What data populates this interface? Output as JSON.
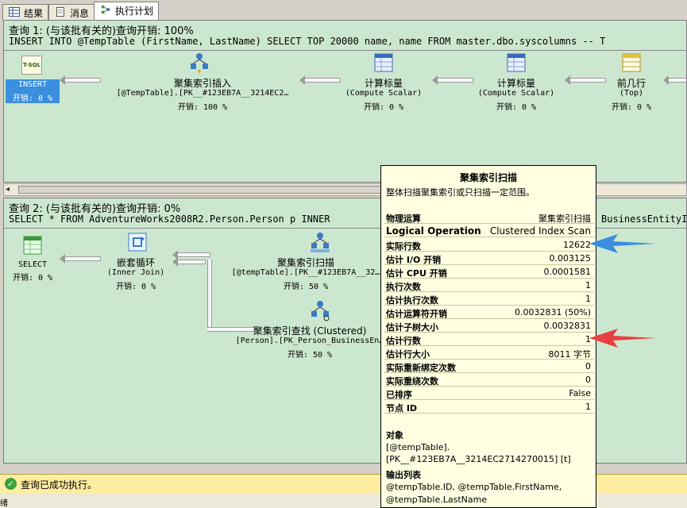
{
  "tabs": [
    {
      "label": "结果",
      "icon": "grid-icon"
    },
    {
      "label": "消息",
      "icon": "document-icon"
    },
    {
      "label": "执行计划",
      "icon": "plan-icon",
      "active": true
    }
  ],
  "query1": {
    "header": "查询 1: (与该批有关的)查询开销: 100%",
    "sql": "INSERT INTO @TempTable (FirstName, LastName) SELECT TOP 20000 name, name FROM master.dbo.syscolumns -- T",
    "nodes": {
      "insert": {
        "icon_label": "T-SQL",
        "title": "INSERT",
        "cost": "开销: 0 %"
      },
      "clustered_insert": {
        "title": "聚集索引插入",
        "sub": "[@TempTable].[PK__#123EB7A__3214EC2…",
        "cost": "开销: 100 %"
      },
      "compute1": {
        "title": "计算标量",
        "sub": "(Compute Scalar)",
        "cost": "开销: 0 %"
      },
      "compute2": {
        "title": "计算标量",
        "sub": "(Compute Scalar)",
        "cost": "开销: 0 %"
      },
      "top": {
        "title": "前几行",
        "sub": "(Top)",
        "cost": "开销: 0 %"
      }
    }
  },
  "query2": {
    "header": "查询 2: (与该批有关的)查询开销: 0%",
    "sql": "SELECT * FROM AdventureWorks2008R2.Person.Person p INNER",
    "sql_tail": "BusinessEntityID",
    "nodes": {
      "select": {
        "title": "SELECT",
        "cost": "开销: 0 %"
      },
      "nested_loop": {
        "title": "嵌套循环",
        "sub": "(Inner Join)",
        "cost": "开销: 0 %"
      },
      "cl_scan": {
        "title": "聚集索引扫描",
        "sub": "[@tempTable].[PK__#123EB7A__32…",
        "cost": "开销: 50 %"
      },
      "cl_seek": {
        "title": "聚集索引查找 (Clustered)",
        "sub": "[Person].[PK_Person_BusinessEn…",
        "cost": "开销: 50 %"
      }
    }
  },
  "tooltip": {
    "title": "聚集索引扫描",
    "description": "整体扫描聚集索引或只扫描一定范围。",
    "rows": [
      {
        "label": "物理运算",
        "value": "聚集索引扫描"
      },
      {
        "label": "Logical Operation",
        "value": "Clustered Index Scan"
      },
      {
        "label": "实际行数",
        "value": "12622"
      },
      {
        "label": "估计 I/O 开销",
        "value": "0.003125"
      },
      {
        "label": "估计 CPU 开销",
        "value": "0.0001581"
      },
      {
        "label": "执行次数",
        "value": "1"
      },
      {
        "label": "估计执行次数",
        "value": "1"
      },
      {
        "label": "估计运算符开销",
        "value": "0.0032831 (50%)"
      },
      {
        "label": "估计子树大小",
        "value": "0.0032831"
      },
      {
        "label": "估计行数",
        "value": "1"
      },
      {
        "label": "估计行大小",
        "value": "8011 字节"
      },
      {
        "label": "实际重新绑定次数",
        "value": "0"
      },
      {
        "label": "实际重绕次数",
        "value": "0"
      },
      {
        "label": "已排序",
        "value": "False"
      },
      {
        "label": "节点 ID",
        "value": "1"
      }
    ],
    "object_label": "对象",
    "object_line1": "[@tempTable].",
    "object_line2": "[PK__#123EB7A__3214EC2714270015] [t]",
    "output_label": "输出列表",
    "output_line1": "@tempTable.ID, @tempTable.FirstName,",
    "output_line2": "@tempTable.LastName"
  },
  "status": {
    "text": "查询已成功执行。",
    "icon": "success-check-icon"
  },
  "bottom_strip": {
    "text": "绪"
  },
  "colors": {
    "pane_bg": "#cce7cf",
    "tooltip_bg": "#ffffe1",
    "status_bg": "#ffeda0",
    "blue_arrow": "#3b8de0",
    "red_arrow": "#e84040"
  }
}
